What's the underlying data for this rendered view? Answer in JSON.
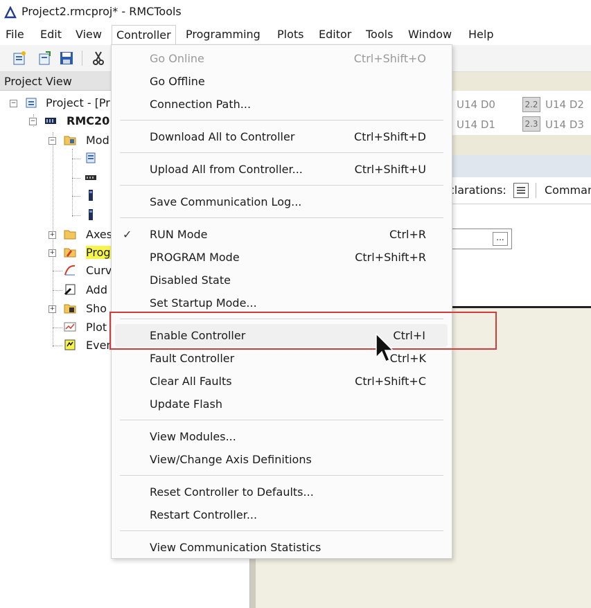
{
  "window": {
    "title": "Project2.rmcproj* - RMCTools"
  },
  "menubar": {
    "items": [
      "File",
      "Edit",
      "View",
      "Controller",
      "Programming",
      "Plots",
      "Editor",
      "Tools",
      "Window",
      "Help"
    ]
  },
  "project_view": {
    "title": "Project View",
    "tree": {
      "project": "Project - [Pr",
      "controller": "RMC20",
      "modules": "Mod",
      "axes": "Axes",
      "programs": "Prog",
      "curves": "Curv",
      "add": "Add",
      "shortcuts": "Sho",
      "plots": "Plot",
      "events": "Even"
    }
  },
  "status": {
    "io": [
      "U14 D0",
      "U14 D1",
      "U14 D2",
      "U14 D3"
    ],
    "io_boxes": [
      "2.2",
      "2.3"
    ]
  },
  "command_bar": {
    "declarations": "clarations:",
    "commands": "Comman"
  },
  "form": {
    "browse_label": "..."
  },
  "controller_menu": {
    "groups": [
      [
        {
          "label": "Go Online",
          "shortcut": "Ctrl+Shift+O",
          "disabled": true
        },
        {
          "label": "Go Offline",
          "shortcut": ""
        },
        {
          "label": "Connection Path...",
          "shortcut": ""
        }
      ],
      [
        {
          "label": "Download All to Controller",
          "shortcut": "Ctrl+Shift+D"
        }
      ],
      [
        {
          "label": "Upload All from Controller...",
          "shortcut": "Ctrl+Shift+U"
        }
      ],
      [
        {
          "label": "Save Communication Log...",
          "shortcut": ""
        }
      ],
      [
        {
          "label": "RUN Mode",
          "shortcut": "Ctrl+R",
          "checked": true
        },
        {
          "label": "PROGRAM Mode",
          "shortcut": "Ctrl+Shift+R"
        },
        {
          "label": "Disabled State",
          "shortcut": ""
        },
        {
          "label": "Set Startup Mode...",
          "shortcut": ""
        }
      ],
      [
        {
          "label": "Enable Controller",
          "shortcut": "Ctrl+I",
          "hover": true
        },
        {
          "label": "Fault Controller",
          "shortcut": "Ctrl+K"
        },
        {
          "label": "Clear All Faults",
          "shortcut": "Ctrl+Shift+C"
        },
        {
          "label": "Update Flash",
          "shortcut": ""
        }
      ],
      [
        {
          "label": "View Modules...",
          "shortcut": ""
        },
        {
          "label": "View/Change Axis Definitions",
          "shortcut": ""
        }
      ],
      [
        {
          "label": "Reset Controller to Defaults...",
          "shortcut": ""
        },
        {
          "label": "Restart Controller...",
          "shortcut": ""
        }
      ],
      [
        {
          "label": "View Communication Statistics",
          "shortcut": ""
        }
      ]
    ],
    "check_glyph": "✓"
  },
  "colors": {
    "highlight_border": "#d13b3b",
    "menu_bg": "#fbfbfb",
    "hover_bg": "#f0f0f0"
  }
}
